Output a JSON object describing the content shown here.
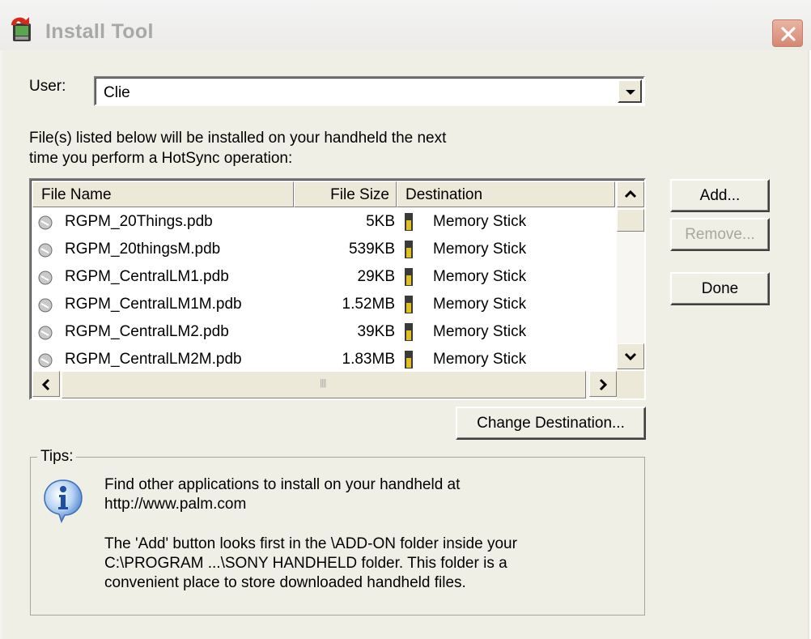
{
  "window": {
    "title": "Install Tool"
  },
  "user": {
    "label": "User:",
    "value": "Clie"
  },
  "info_text": [
    "File(s) listed below will be installed on your handheld the next",
    "time you perform a HotSync operation:"
  ],
  "list": {
    "headers": {
      "filename": "File Name",
      "filesize": "File Size",
      "destination": "Destination"
    },
    "rows": [
      {
        "filename": "RGPM_20Things.pdb",
        "filesize": "5KB",
        "destination": "Memory Stick"
      },
      {
        "filename": "RGPM_20thingsM.pdb",
        "filesize": "539KB",
        "destination": "Memory Stick"
      },
      {
        "filename": "RGPM_CentralLM1.pdb",
        "filesize": "29KB",
        "destination": "Memory Stick"
      },
      {
        "filename": "RGPM_CentralLM1M.pdb",
        "filesize": "1.52MB",
        "destination": "Memory Stick"
      },
      {
        "filename": "RGPM_CentralLM2.pdb",
        "filesize": "39KB",
        "destination": "Memory Stick"
      },
      {
        "filename": "RGPM_CentralLM2M.pdb",
        "filesize": "1.83MB",
        "destination": "Memory Stick"
      }
    ]
  },
  "buttons": {
    "add": "Add...",
    "remove": "Remove...",
    "done": "Done",
    "change_destination": "Change Destination..."
  },
  "tips": {
    "label": "Tips:",
    "line1": "Find other applications to install on your handheld at",
    "line2": "http://www.palm.com",
    "line3": "The 'Add' button looks first in the \\ADD-ON folder inside your",
    "line4": "C:\\PROGRAM ...\\SONY HANDHELD folder. This folder is a",
    "line5": "convenient place to store downloaded handheld files."
  }
}
